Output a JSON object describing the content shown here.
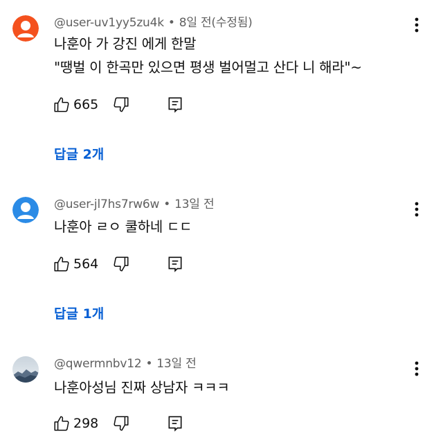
{
  "comments": [
    {
      "username": "@user-uv1yy5zu4k",
      "time": "8일 전(수정됨)",
      "lines": [
        "나훈아 가 강진 에게 한말",
        "\"땡벌 이 한곡만 있으면 평생 벌어멀고 산다 니 해라\"~"
      ],
      "likes": "665",
      "replies": "답글 2개",
      "avatar": "orange-person-icon",
      "avatar_color": "#f4511e"
    },
    {
      "username": "@user-jl7hs7rw6w",
      "time": "13일 전",
      "lines": [
        "나훈아 ㄹㅇ 쿨하네 ㄷㄷ"
      ],
      "likes": "564",
      "replies": "답글 1개",
      "avatar": "blue-person-icon",
      "avatar_color": "#2b8be6"
    },
    {
      "username": "@qwermnbv12",
      "time": "13일 전",
      "lines": [
        "나훈아성님 진짜 상남자 ㅋㅋㅋ"
      ],
      "likes": "298",
      "avatar": "mountain-photo-avatar"
    }
  ],
  "colors": {
    "link": "#065fd4",
    "meta": "#606060",
    "text": "#0f0f0f"
  },
  "icons": [
    "thumbs-up-icon",
    "thumbs-down-icon",
    "reply-comment-icon",
    "more-vert-icon"
  ]
}
